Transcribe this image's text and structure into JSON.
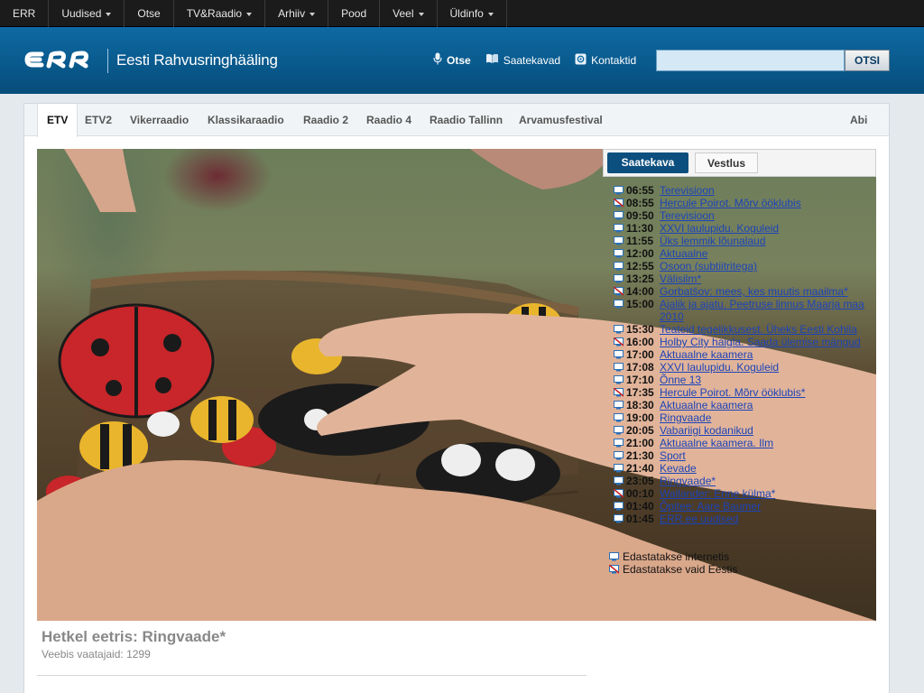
{
  "topnav": [
    {
      "label": "ERR",
      "caret": false
    },
    {
      "label": "Uudised",
      "caret": true
    },
    {
      "label": "Otse",
      "caret": false
    },
    {
      "label": "TV&Raadio",
      "caret": true
    },
    {
      "label": "Arhiiv",
      "caret": true
    },
    {
      "label": "Pood",
      "caret": false
    },
    {
      "label": "Veel",
      "caret": true
    },
    {
      "label": "Üldinfo",
      "caret": true
    }
  ],
  "header": {
    "brand": "Eesti Rahvusringhääling",
    "links": [
      {
        "label": "Otse",
        "icon": "microphone-icon"
      },
      {
        "label": "Saatekavad",
        "icon": "book-icon"
      },
      {
        "label": "Kontaktid",
        "icon": "contact-icon"
      }
    ],
    "search_value": "",
    "search_button": "OTSI"
  },
  "channels": {
    "tabs": [
      "ETV",
      "ETV2",
      "Vikerraadio",
      "Klassikaraadio",
      "Raadio 2",
      "Raadio 4",
      "Raadio Tallinn",
      "Arvamusfestival"
    ],
    "active": "ETV",
    "help": "Abi"
  },
  "schedule": {
    "tabs": [
      "Saatekava",
      "Vestlus"
    ],
    "items": [
      {
        "time": "06:55",
        "title": "Terevisioon",
        "scope": "internet"
      },
      {
        "time": "08:55",
        "title": "Hercule Poirot. Mõrv ööklubis",
        "scope": "estonia"
      },
      {
        "time": "09:50",
        "title": "Terevisioon",
        "scope": "internet"
      },
      {
        "time": "11:30",
        "title": "XXVI laulupidu. Koguleid",
        "scope": "internet"
      },
      {
        "time": "11:55",
        "title": "Üks lemmik lõunalaud",
        "scope": "internet"
      },
      {
        "time": "12:00",
        "title": "Aktuaalne",
        "scope": "internet"
      },
      {
        "time": "12:55",
        "title": "Osoon (subtiitritega)",
        "scope": "internet"
      },
      {
        "time": "13:25",
        "title": "Välisilm*",
        "scope": "internet"
      },
      {
        "time": "14:00",
        "title": "Gorbatšov: mees, kes muutis maailma*",
        "scope": "estonia"
      },
      {
        "time": "15:00",
        "title": "Ajalik ja ajatu. Peetruse linnus Maarja maa 2010",
        "scope": "internet"
      },
      {
        "time": "15:30",
        "title": "Teateid tegelikkusest. Üheks Eesti Kohila",
        "scope": "internet"
      },
      {
        "time": "16:00",
        "title": "Holby City haigla. Saada ülemise mängud",
        "scope": "estonia"
      },
      {
        "time": "17:00",
        "title": "Aktuaalne kaamera",
        "scope": "internet"
      },
      {
        "time": "17:08",
        "title": "XXVI laulupidu. Koguleid",
        "scope": "internet"
      },
      {
        "time": "17:10",
        "title": "Õnne 13",
        "scope": "internet"
      },
      {
        "time": "17:35",
        "title": "Hercule Poirot. Mõrv ööklubis*",
        "scope": "estonia"
      },
      {
        "time": "18:30",
        "title": "Aktuaalne kaamera",
        "scope": "internet"
      },
      {
        "time": "19:00",
        "title": "Ringvaade",
        "scope": "internet"
      },
      {
        "time": "20:05",
        "title": "Vabariigi kodanikud",
        "scope": "internet"
      },
      {
        "time": "21:00",
        "title": "Aktuaalne kaamera. Ilm",
        "scope": "internet"
      },
      {
        "time": "21:30",
        "title": "Sport",
        "scope": "internet"
      },
      {
        "time": "21:40",
        "title": "Kevade",
        "scope": "internet"
      },
      {
        "time": "23:05",
        "title": "Ringvaade*",
        "scope": "internet"
      },
      {
        "time": "00:10",
        "title": "Wallander: Enne külma*",
        "scope": "estonia"
      },
      {
        "time": "01:40",
        "title": "Õpitee: Aare Baumer",
        "scope": "internet"
      },
      {
        "time": "01:45",
        "title": "ERR.ee uudised",
        "scope": "internet"
      }
    ],
    "legend": [
      {
        "scope": "internet",
        "label": "Edastatakse internetis"
      },
      {
        "scope": "estonia",
        "label": "Edastatakse vaid Eestis"
      }
    ]
  },
  "player": {
    "now_playing": "Hetkel eetris: Ringvaade*",
    "viewers": "Veebis vaatajaid: 1299"
  },
  "colors": {
    "accent": "#0c4f7e",
    "header_blue": "#095a8d",
    "link": "#1d44b7",
    "estonia_only": "#c81e1e"
  }
}
